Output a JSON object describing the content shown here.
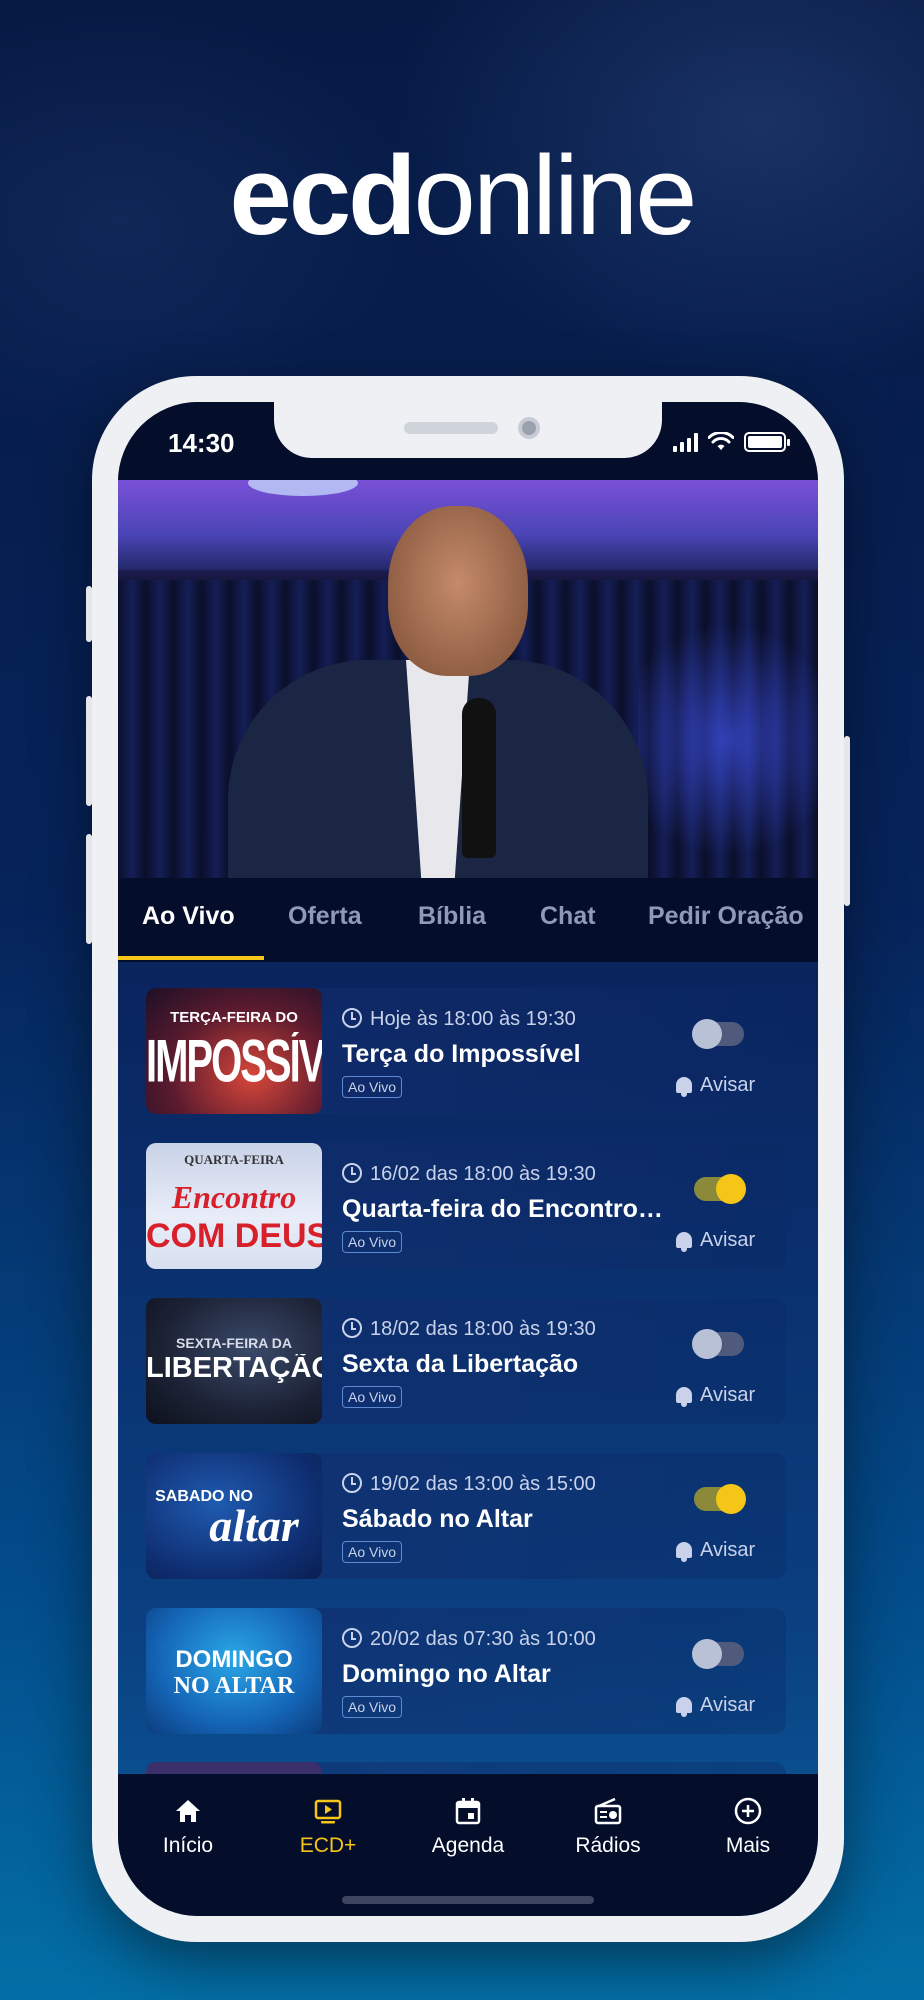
{
  "brand": {
    "part1": "ecd",
    "part2": "online"
  },
  "status_bar": {
    "time": "14:30"
  },
  "tabs": [
    {
      "label": "Ao Vivo",
      "active": true
    },
    {
      "label": "Oferta",
      "active": false
    },
    {
      "label": "Bíblia",
      "active": false
    },
    {
      "label": "Chat",
      "active": false
    },
    {
      "label": "Pedir Oração",
      "active": false
    }
  ],
  "events": [
    {
      "time": "Hoje às 18:00 às 19:30",
      "title": "Terça do Impossível",
      "badge": "Ao Vivo",
      "notify": false,
      "notify_label": "Avisar",
      "thumb_line1": "TERÇA-FEIRA DO",
      "thumb_line2": "IMPOSSÍVEL"
    },
    {
      "time": "16/02 das 18:00 às 19:30",
      "title": "Quarta-feira do Encontro com Deus",
      "badge": "Ao Vivo",
      "notify": true,
      "notify_label": "Avisar",
      "thumb_line1": "QUARTA-FEIRA",
      "thumb_line2": "Encontro",
      "thumb_line3": "COM DEUS"
    },
    {
      "time": "18/02 das 18:00 às 19:30",
      "title": "Sexta da Libertação",
      "badge": "Ao Vivo",
      "notify": false,
      "notify_label": "Avisar",
      "thumb_line1": "SEXTA-FEIRA DA",
      "thumb_line2": "LIBERTAÇÃO"
    },
    {
      "time": "19/02 das 13:00 às 15:00",
      "title": "Sábado no Altar",
      "badge": "Ao Vivo",
      "notify": true,
      "notify_label": "Avisar",
      "thumb_line1": "SÁBADO NO",
      "thumb_line2": "altar"
    },
    {
      "time": "20/02 das 07:30 às 10:00",
      "title": "Domingo no Altar",
      "badge": "Ao Vivo",
      "notify": false,
      "notify_label": "Avisar",
      "thumb_line1": "DOMINGO",
      "thumb_line2": "NO ALTAR"
    }
  ],
  "bottom_nav": [
    {
      "label": "Início",
      "icon": "home-icon",
      "active": false
    },
    {
      "label": "ECD+",
      "icon": "play-screen-icon",
      "active": true
    },
    {
      "label": "Agenda",
      "icon": "calendar-icon",
      "active": false
    },
    {
      "label": "Rádios",
      "icon": "radio-icon",
      "active": false
    },
    {
      "label": "Mais",
      "icon": "plus-circle-icon",
      "active": false
    }
  ],
  "colors": {
    "accent": "#f5c518",
    "background_top": "#071a44",
    "background_bottom": "#036fa6",
    "bar": "#040d2a"
  }
}
